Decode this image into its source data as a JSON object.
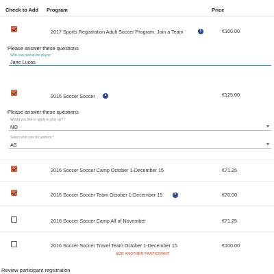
{
  "header": {
    "check_label": "Check to Add",
    "program_label": "Program",
    "price_label": "Price"
  },
  "rows": [
    {
      "checked": true,
      "program": "2017 Sports Registration Adult Soccer Program: Join a Team",
      "price": "€100.00",
      "has_info": true
    },
    {
      "checked": true,
      "program": "2016 Soccer Soccer",
      "price": "€125.00",
      "has_info": true
    },
    {
      "checked": true,
      "program": "2016 Soccer Soccer Camp October 1-December 15",
      "price": "€71.25",
      "has_info": false
    },
    {
      "checked": true,
      "program": "2016 Soccer Soccer Team October 1-December 15",
      "price": "€70.00",
      "has_info": true
    },
    {
      "checked": false,
      "program": "2016 Soccer Soccer Camp All of November",
      "price": "€71.25",
      "has_info": false
    },
    {
      "checked": false,
      "program": "2016 Soccer Soccer Travel Team October 1-December 15",
      "price": "€100.00",
      "has_info": false
    }
  ],
  "questions1": {
    "heading": "Please answer these questions",
    "field_label": "Who can pickup the player",
    "field_value": "Jane Lucas"
  },
  "questions2": {
    "heading": "Please answer these questions",
    "select1_label": "Would you like to apply to play up? *",
    "select1_value": "NO",
    "select2_label": "Select shirt size for uniform *",
    "select2_value": "AS"
  },
  "add_participant_label": "ADD ANOTHER PARTICIPANT",
  "footer_label": "Review participant registration",
  "colors": {
    "accent": "#e0734f",
    "focus": "#1aa39a",
    "info": "#2f4a8f"
  }
}
